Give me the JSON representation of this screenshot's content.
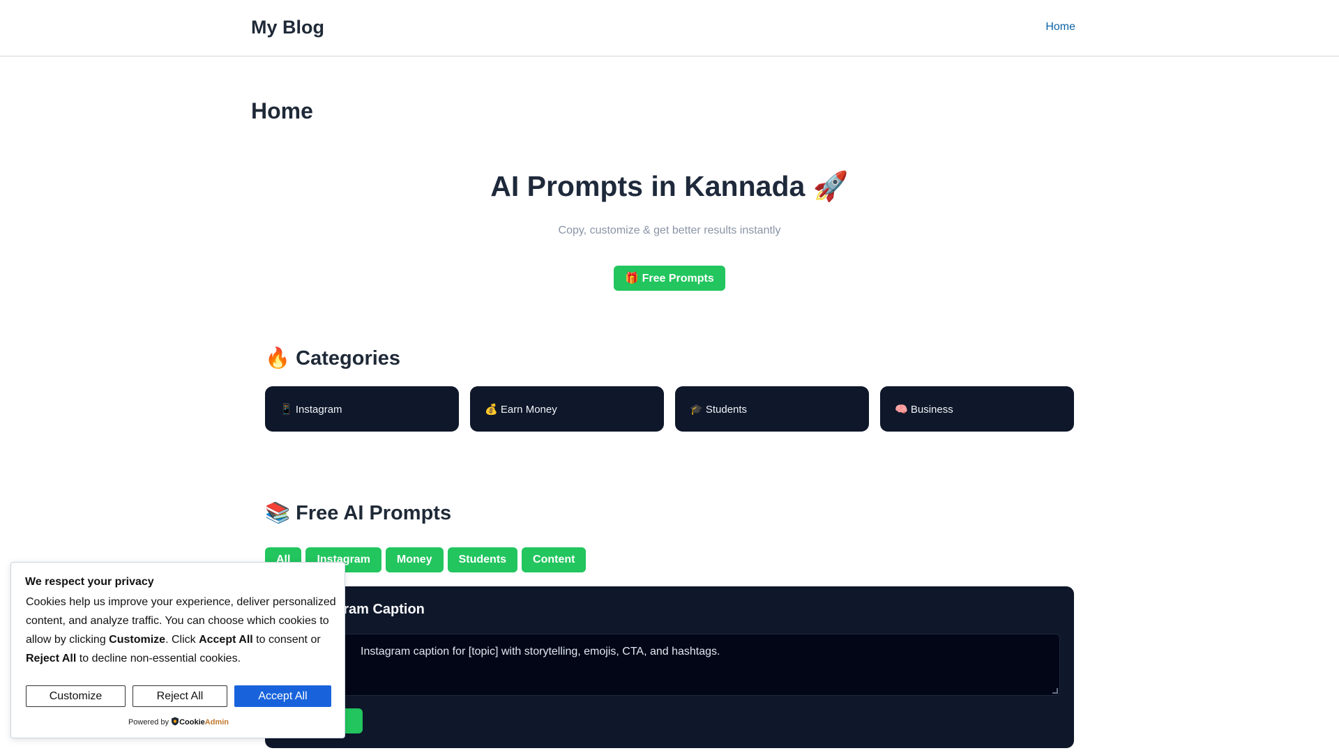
{
  "header": {
    "site_title": "My Blog",
    "nav_home": "Home"
  },
  "page": {
    "title": "Home"
  },
  "hero": {
    "title": "AI Prompts in Kannada 🚀",
    "subtitle": "Copy, customize & get better results instantly",
    "cta_label": "🎁 Free Prompts"
  },
  "categories": {
    "title": "🔥 Categories",
    "items": [
      {
        "label": "📱 Instagram"
      },
      {
        "label": "💰 Earn Money"
      },
      {
        "label": "🎓 Students"
      },
      {
        "label": "🧠 Business"
      }
    ]
  },
  "free_prompts": {
    "title": "📚 Free AI Prompts",
    "filters": [
      "All",
      "Instagram",
      "Money",
      "Students",
      "Content"
    ],
    "card": {
      "title": "gram Caption",
      "text_line1": "Instagram caption for [topic] with storytelling, emojis, CTA, and hashtags."
    }
  },
  "cookie": {
    "title": "We respect your privacy",
    "body_1": "Cookies help us improve your experience, deliver personalized content, and analyze traffic. You can choose which cookies to allow by clicking ",
    "body_customize": "Customize",
    "body_2": ". Click ",
    "body_accept": "Accept All",
    "body_3": " to consent or ",
    "body_reject": "Reject All",
    "body_4": " to decline non-essential cookies.",
    "customize_label": "Customize",
    "reject_label": "Reject All",
    "accept_label": "Accept All",
    "powered_by": "Powered by",
    "brand_a": "Cookie",
    "brand_b": "Admin"
  },
  "colors": {
    "accent_green": "#22c55e",
    "card_dark": "#0f172a",
    "link_blue": "#0b62a4",
    "cookie_accept_blue": "#1863dc"
  }
}
